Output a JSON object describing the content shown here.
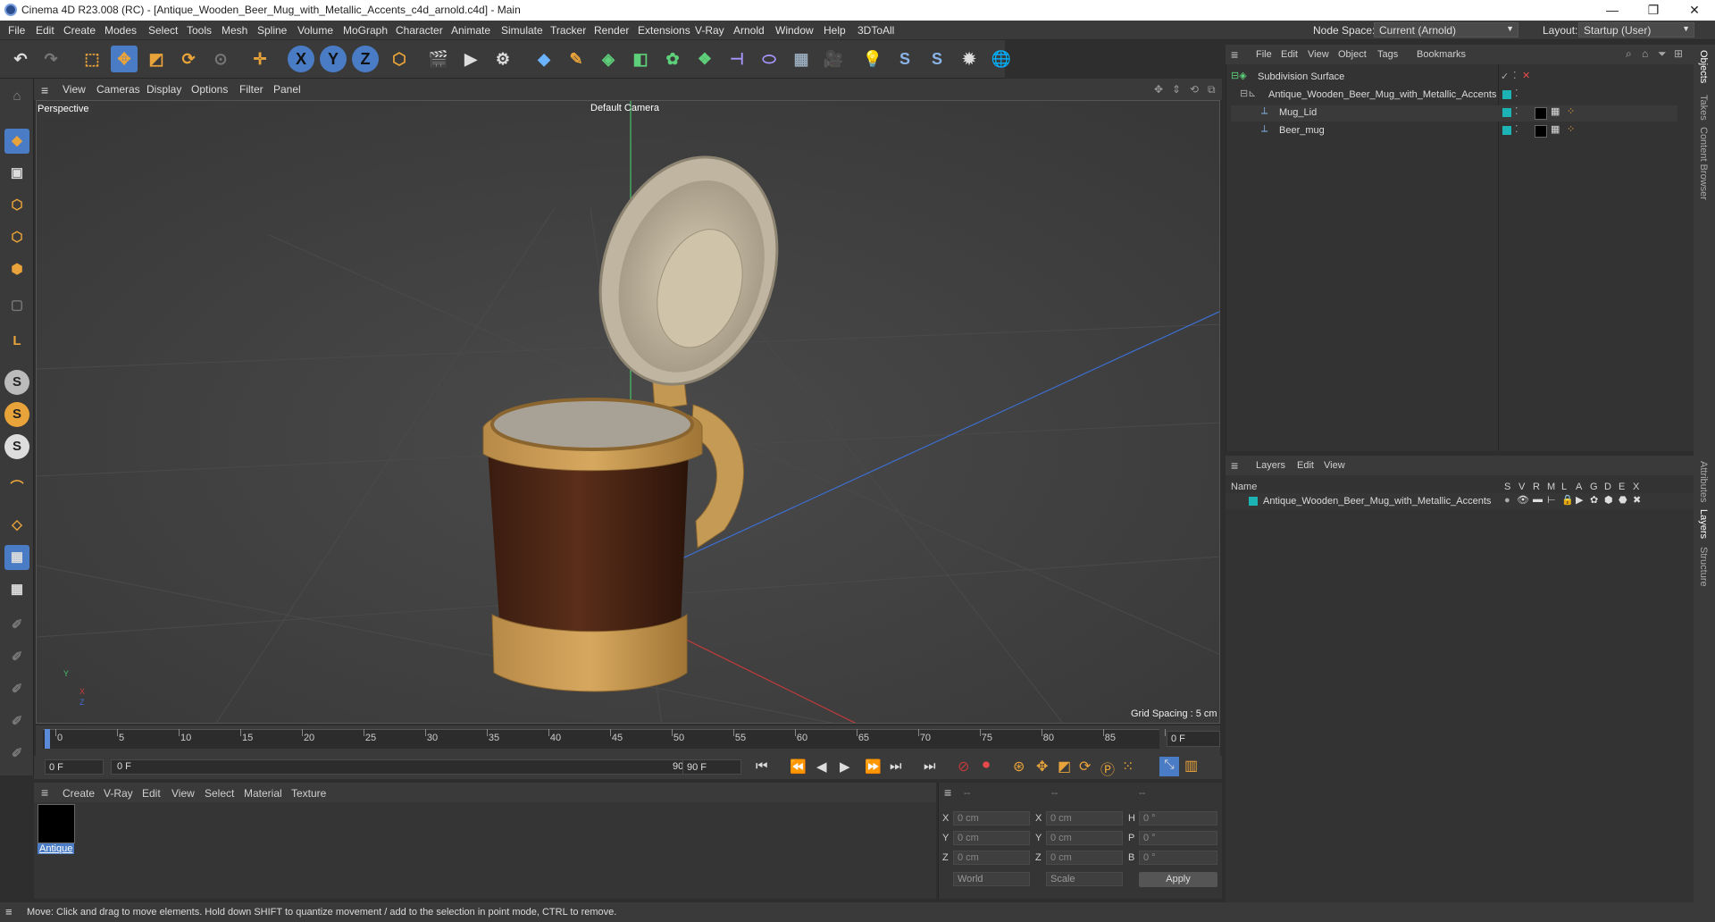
{
  "window": {
    "title": "Cinema 4D R23.008 (RC) - [Antique_Wooden_Beer_Mug_with_Metallic_Accents_c4d_arnold.c4d] - Main",
    "minimize": "—",
    "maximize": "❐",
    "close": "✕"
  },
  "menubar": {
    "items": [
      "File",
      "Edit",
      "Create",
      "Modes",
      "Select",
      "Tools",
      "Mesh",
      "Spline",
      "Volume",
      "MoGraph",
      "Character",
      "Animate",
      "Simulate",
      "Tracker",
      "Render",
      "Extensions",
      "V-Ray",
      "Arnold",
      "Window",
      "Help",
      "3DToAll"
    ],
    "node_space_label": "Node Space:",
    "node_space_value": "Current (Arnold)",
    "layout_label": "Layout:",
    "layout_value": "Startup (User)"
  },
  "viewport": {
    "menu": [
      "View",
      "Cameras",
      "Display",
      "Options",
      "Filter",
      "Panel"
    ],
    "projection": "Perspective",
    "camera": "Default Camera",
    "grid_spacing": "Grid Spacing : 5 cm",
    "axis_y": "Y",
    "axis_z": "Z",
    "axis_x": "X"
  },
  "timeline": {
    "ticks": [
      "0",
      "5",
      "10",
      "15",
      "20",
      "25",
      "30",
      "35",
      "40",
      "45",
      "50",
      "55",
      "60",
      "65",
      "70",
      "75",
      "80",
      "85",
      "90"
    ],
    "current_frame": "0 F",
    "start_field": "0 F",
    "range_start": "0 F",
    "range_end": "90 F",
    "end_field": "90 F"
  },
  "material_manager": {
    "menu": [
      "Create",
      "V-Ray",
      "Edit",
      "View",
      "Select",
      "Material",
      "Texture"
    ],
    "materials": [
      {
        "name": "Antique"
      }
    ]
  },
  "coordinates": {
    "header": [
      "--",
      "--",
      "--"
    ],
    "rows": [
      {
        "a": "X",
        "av": "0 cm",
        "b": "X",
        "bv": "0 cm",
        "c": "H",
        "cv": "0 °"
      },
      {
        "a": "Y",
        "av": "0 cm",
        "b": "Y",
        "bv": "0 cm",
        "c": "P",
        "cv": "0 °"
      },
      {
        "a": "Z",
        "av": "0 cm",
        "b": "Z",
        "bv": "0 cm",
        "c": "B",
        "cv": "0 °"
      }
    ],
    "space": "World",
    "mode": "Scale",
    "apply": "Apply"
  },
  "object_manager": {
    "menu": [
      "File",
      "Edit",
      "View",
      "Object",
      "Tags",
      "Bookmarks"
    ],
    "objects": [
      {
        "name": "Subdivision Surface"
      },
      {
        "name": "Antique_Wooden_Beer_Mug_with_Metallic_Accents"
      },
      {
        "name": "Mug_Lid"
      },
      {
        "name": "Beer_mug"
      }
    ]
  },
  "layer_manager": {
    "menu": [
      "Layers",
      "Edit",
      "View"
    ],
    "name_header": "Name",
    "flags": [
      "S",
      "V",
      "R",
      "M",
      "L",
      "A",
      "G",
      "D",
      "E",
      "X"
    ],
    "layers": [
      {
        "name": "Antique_Wooden_Beer_Mug_with_Metallic_Accents",
        "color": "#1bb3b3"
      }
    ]
  },
  "right_tabs": [
    "Objects",
    "Takes",
    "Content Browser",
    "Attributes",
    "Layers",
    "Structure"
  ],
  "status": "Move: Click and drag to move elements. Hold down SHIFT to quantize movement / add to the selection in point mode, CTRL to remove.",
  "colors": {
    "accent": "#1bb3b3",
    "selection": "#4a7bc5",
    "toolbar_orange": "#e8a33a"
  }
}
